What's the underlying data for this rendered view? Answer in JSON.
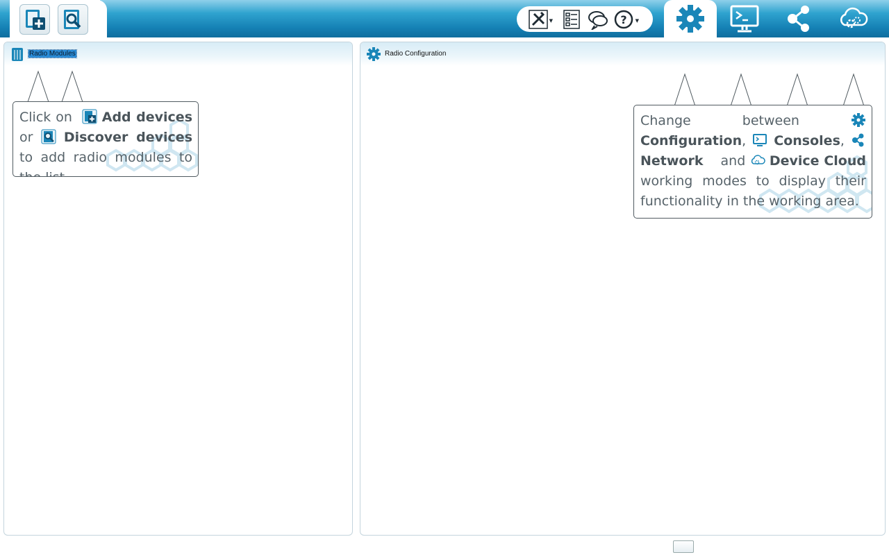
{
  "toolbar": {
    "left_buttons": [
      {
        "name": "add-devices-button",
        "label": "Add devices"
      },
      {
        "name": "discover-devices-button",
        "label": "Discover devices"
      }
    ],
    "tools": [
      "xctu-tools-icon",
      "profile-list-icon",
      "feedback-icon",
      "help-icon"
    ],
    "modes": [
      "configuration-icon",
      "consoles-icon",
      "network-icon",
      "device-cloud-icon"
    ],
    "active_mode": "Configuration"
  },
  "left_panel": {
    "title": "Radio Modules",
    "hint": {
      "p1": "Click on",
      "add": "Add devices",
      "p2": "or",
      "discover": "Discover devices",
      "p3": "to add radio modules to the list."
    }
  },
  "right_panel": {
    "title": "Radio Configuration",
    "hint": {
      "p1": "Change between",
      "config": "Configuration",
      "c1": ",",
      "consoles": "Consoles",
      "c2": ",",
      "network": "Network",
      "and": "and",
      "cloud": "Device Cloud",
      "p2": "working modes to display their functionality in the working area."
    }
  },
  "colors": {
    "accent": "#1a86b8",
    "toolbar_dark": "#0f6e9e",
    "text": "#57636a"
  }
}
